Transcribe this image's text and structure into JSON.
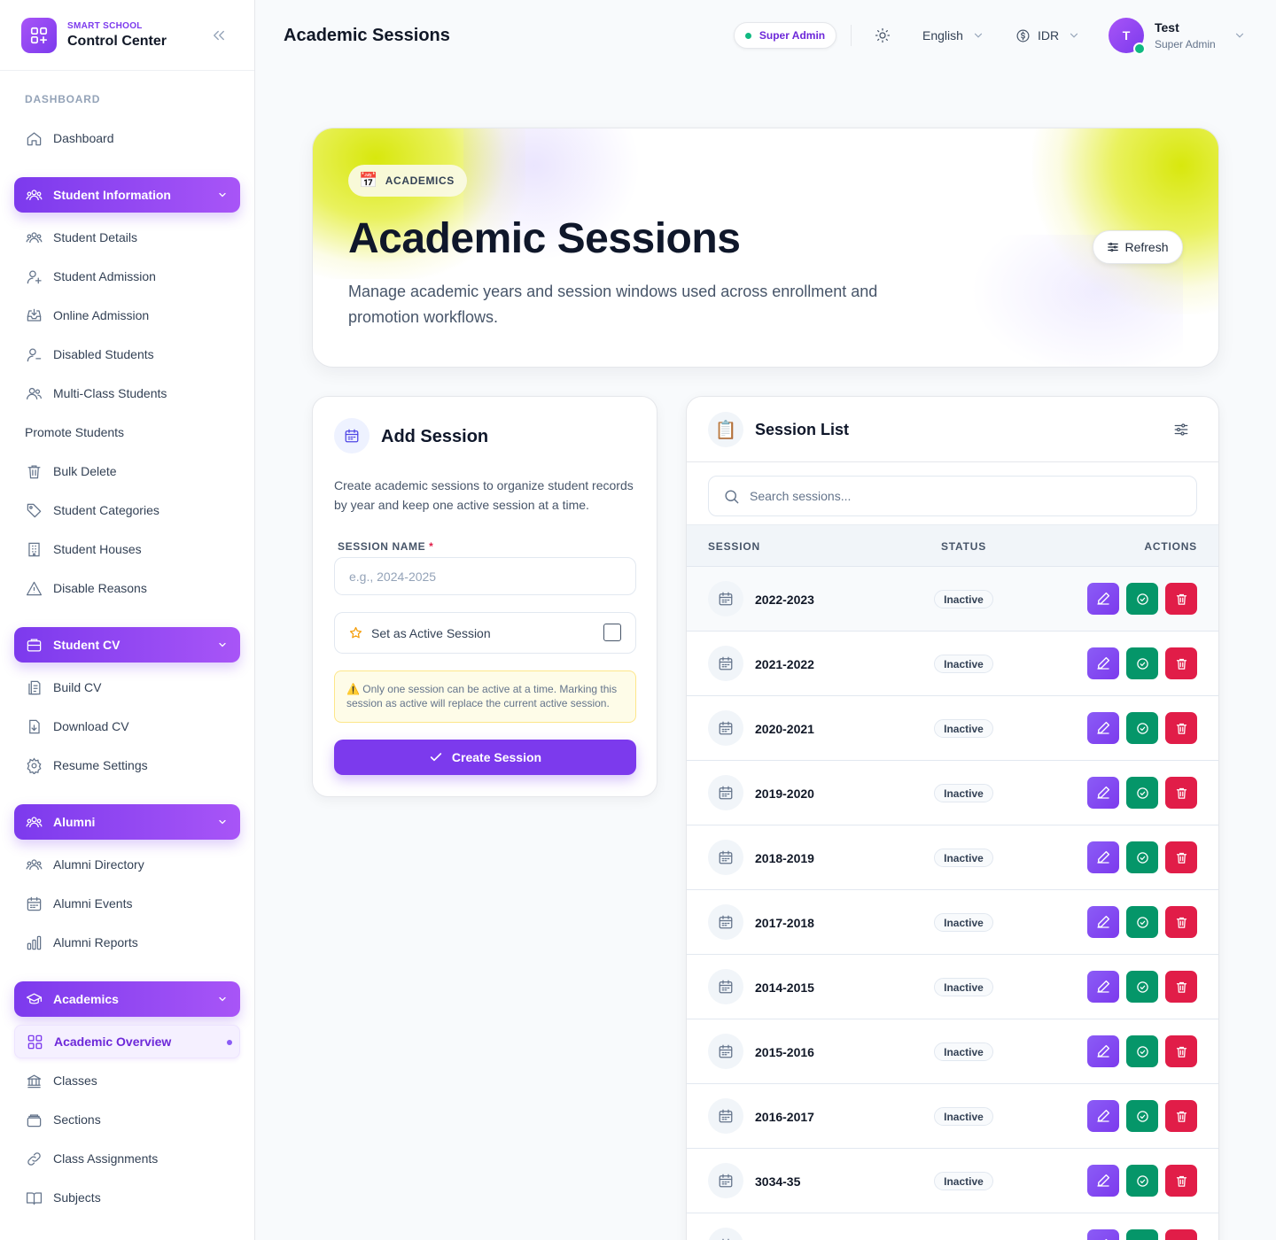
{
  "brand": {
    "subtitle": "SMART SCHOOL",
    "title": "Control Center"
  },
  "sidebar": {
    "section_label": "DASHBOARD",
    "dashboard": "Dashboard",
    "student_information": {
      "label": "Student Information",
      "items": [
        "Student Details",
        "Student Admission",
        "Online Admission",
        "Disabled Students",
        "Multi-Class Students",
        "Promote Students",
        "Bulk Delete",
        "Student Categories",
        "Student Houses",
        "Disable Reasons"
      ]
    },
    "student_cv": {
      "label": "Student CV",
      "items": [
        "Build CV",
        "Download CV",
        "Resume Settings"
      ]
    },
    "alumni": {
      "label": "Alumni",
      "items": [
        "Alumni Directory",
        "Alumni Events",
        "Alumni Reports"
      ]
    },
    "academics": {
      "label": "Academics",
      "items": [
        "Academic Overview",
        "Classes",
        "Sections",
        "Class Assignments",
        "Subjects"
      ]
    }
  },
  "header": {
    "title": "Academic Sessions",
    "role_pill": "Super Admin",
    "language": "English",
    "currency": "IDR",
    "user": {
      "initial": "T",
      "name": "Test",
      "role": "Super Admin"
    }
  },
  "hero": {
    "chip_emoji": "📅",
    "chip_label": "ACADEMICS",
    "title": "Academic Sessions",
    "description": "Manage academic years and session windows used across enrollment and promotion workflows.",
    "refresh_label": "Refresh"
  },
  "add_session": {
    "title": "Add Session",
    "description": "Create academic sessions to organize student records by year and keep one active session at a time.",
    "field_label": "SESSION NAME",
    "required_mark": "*",
    "placeholder": "e.g., 2024-2025",
    "value": "",
    "active_label": "Set as Active Session",
    "active_checked": false,
    "warning": "⚠️ Only one session can be active at a time. Marking this session as active will replace the current active session.",
    "create_label": "Create Session"
  },
  "session_list": {
    "title": "Session List",
    "icon_emoji": "📋",
    "search_placeholder": "Search sessions...",
    "columns": {
      "session": "SESSION",
      "status": "STATUS",
      "actions": "ACTIONS"
    },
    "rows": [
      {
        "name": "2022-2023",
        "status": "Inactive"
      },
      {
        "name": "2021-2022",
        "status": "Inactive"
      },
      {
        "name": "2020-2021",
        "status": "Inactive"
      },
      {
        "name": "2019-2020",
        "status": "Inactive"
      },
      {
        "name": "2018-2019",
        "status": "Inactive"
      },
      {
        "name": "2017-2018",
        "status": "Inactive"
      },
      {
        "name": "2014-2015",
        "status": "Inactive"
      },
      {
        "name": "2015-2016",
        "status": "Inactive"
      },
      {
        "name": "2016-2017",
        "status": "Inactive"
      },
      {
        "name": "3034-35",
        "status": "Inactive"
      },
      {
        "name": "",
        "status": ""
      }
    ]
  },
  "colors": {
    "accent": "#7c3aed",
    "success": "#059669",
    "danger": "#e11d48",
    "online": "#10b981"
  }
}
